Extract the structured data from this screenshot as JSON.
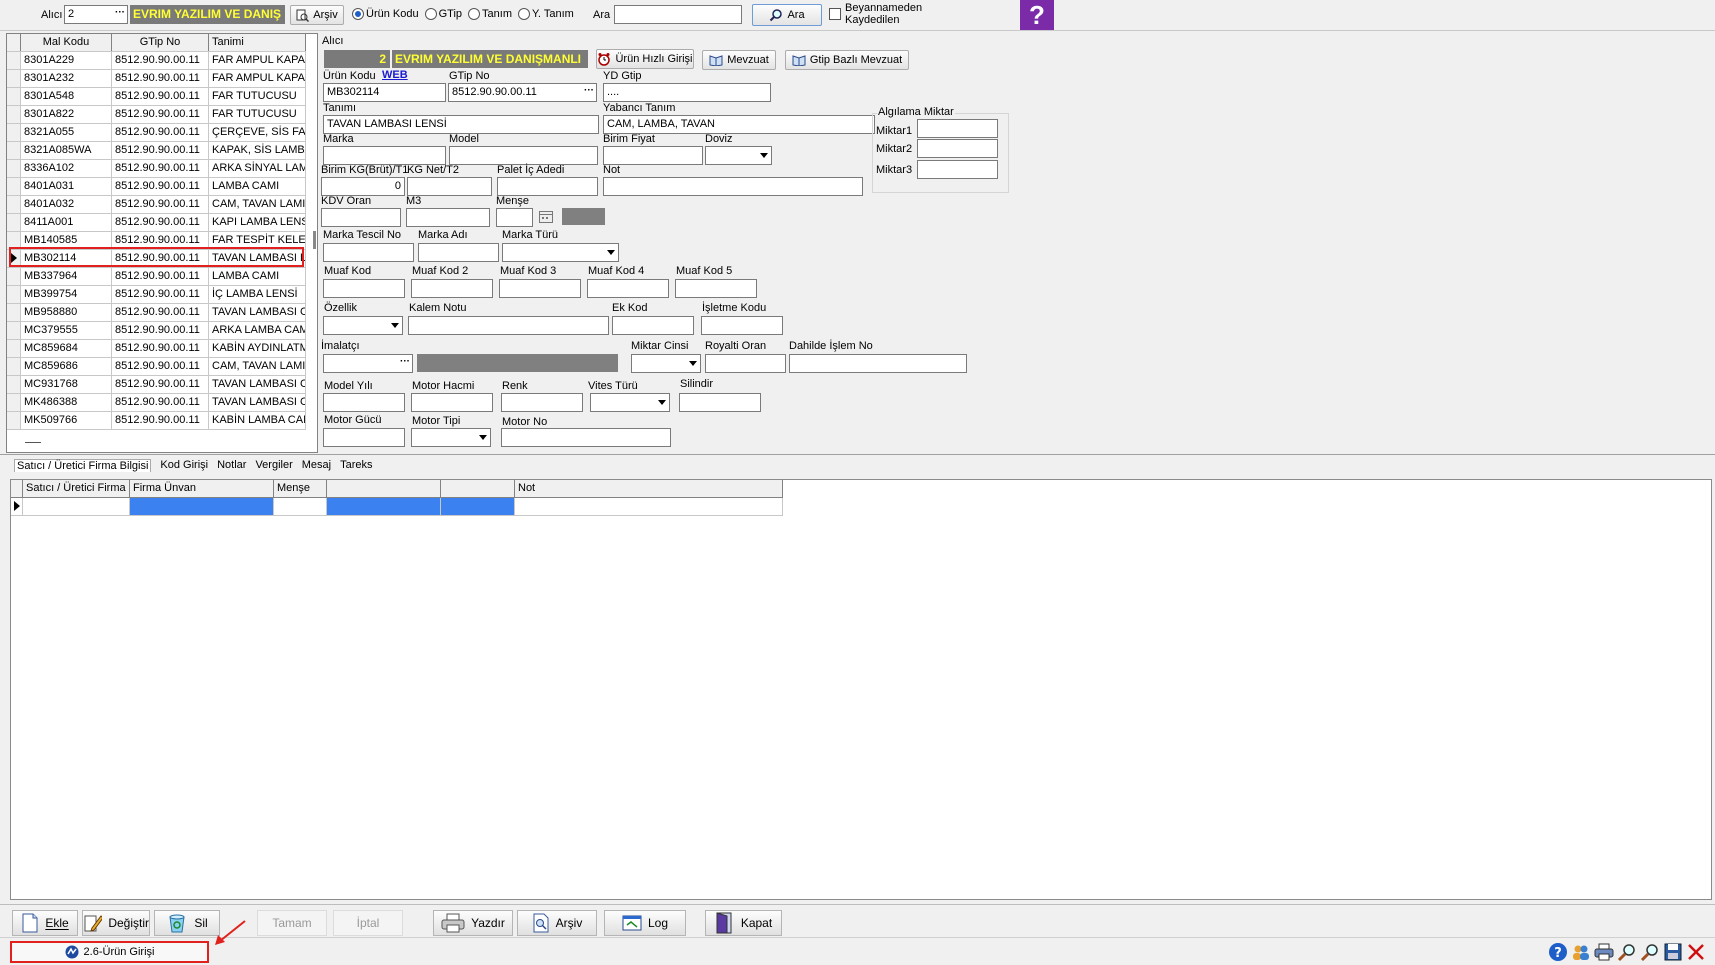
{
  "toolbar": {
    "alici_label": "Alıcı",
    "alici_value": "2",
    "company_name": "EVRIM YAZILIM VE DANIŞ",
    "archive_button": "Arşiv",
    "radio_options": [
      "Ürün Kodu",
      "GTip",
      "Tanım",
      "Y. Tanım"
    ],
    "radio_selected": 0,
    "search_label": "Ara",
    "search_value": "",
    "search_button": "Ara",
    "declared_checkbox": "Beyannameden Kaydedilen"
  },
  "left_grid": {
    "headers": [
      "Mal Kodu",
      "GTip No",
      "Tanimi"
    ],
    "rows": [
      [
        "8301A229",
        "8512.90.90.00.11",
        "FAR AMPUL KAPA"
      ],
      [
        "8301A232",
        "8512.90.90.00.11",
        "FAR AMPUL KAPA"
      ],
      [
        "8301A548",
        "8512.90.90.00.11",
        "FAR TUTUCUSU"
      ],
      [
        "8301A822",
        "8512.90.90.00.11",
        "FAR TUTUCUSU"
      ],
      [
        "8321A055",
        "8512.90.90.00.11",
        "ÇERÇEVE, SİS FAF"
      ],
      [
        "8321A085WA",
        "8512.90.90.00.11",
        "KAPAK, SİS LAMBA"
      ],
      [
        "8336A102",
        "8512.90.90.00.11",
        "ARKA SİNYAL LAM"
      ],
      [
        "8401A031",
        "8512.90.90.00.11",
        "LAMBA CAMI"
      ],
      [
        "8401A032",
        "8512.90.90.00.11",
        "CAM, TAVAN LAMI"
      ],
      [
        "8411A001",
        "8512.90.90.00.11",
        "KAPI LAMBA LENS"
      ],
      [
        "MB140585",
        "8512.90.90.00.11",
        "FAR TESPİT KELE"
      ],
      [
        "MB302114",
        "8512.90.90.00.11",
        "TAVAN LAMBASI L"
      ],
      [
        "MB337964",
        "8512.90.90.00.11",
        "LAMBA CAMI"
      ],
      [
        "MB399754",
        "8512.90.90.00.11",
        "İÇ LAMBA LENSİ"
      ],
      [
        "MB958880",
        "8512.90.90.00.11",
        "TAVAN LAMBASI C"
      ],
      [
        "MC379555",
        "8512.90.90.00.11",
        "ARKA LAMBA CAM"
      ],
      [
        "MC859684",
        "8512.90.90.00.11",
        "KABİN AYDINLATM"
      ],
      [
        "MC859686",
        "8512.90.90.00.11",
        "CAM, TAVAN LAMI"
      ],
      [
        "MC931768",
        "8512.90.90.00.11",
        "TAVAN LAMBASI C"
      ],
      [
        "MK486388",
        "8512.90.90.00.11",
        "TAVAN LAMBASI C"
      ],
      [
        "MK509766",
        "8512.90.90.00.11",
        "KABİN LAMBA CAM"
      ]
    ],
    "selected_index": 11
  },
  "form": {
    "alici_label": "Alıcı",
    "alici_number": "2",
    "alici_name": "EVRIM YAZILIM VE DANIŞMANLI",
    "quick_entry_button": "Ürün Hızlı Girişi",
    "mevzuat_button": "Mevzuat",
    "gtip_mevzuat_button": "Gtip Bazlı Mevzuat",
    "urun_kodu_label": "Ürün Kodu",
    "web_link": "WEB",
    "urun_kodu_value": "MB302114",
    "gtip_no_label": "GTip No",
    "gtip_no_value": "8512.90.90.00.11",
    "yd_gtip_label": "YD Gtip",
    "yd_gtip_value": "....",
    "tanimi_label": "Tanımı",
    "tanimi_value": "TAVAN LAMBASI LENSİ",
    "yabanci_tanim_label": "Yabancı Tanım",
    "yabanci_tanim_value": "CAM, LAMBA, TAVAN",
    "marka_label": "Marka",
    "model_label": "Model",
    "birim_fiyat_label": "Birim Fiyat",
    "doviz_label": "Doviz",
    "birim_kg_label": "Birim KG(Brüt)/T1",
    "birim_kg_value": "0",
    "kg_net_label": "KG Net/T2",
    "palet_label": "Palet İç Adedi",
    "not_label": "Not",
    "kdv_label": "KDV Oran",
    "m3_label": "M3",
    "mense_label": "Menşe",
    "marka_tescil_label": "Marka Tescil No",
    "marka_adi_label": "Marka Adı",
    "marka_turu_label": "Marka Türü",
    "muaf_labels": [
      "Muaf Kod",
      "Muaf Kod 2",
      "Muaf Kod 3",
      "Muaf Kod 4",
      "Muaf Kod 5"
    ],
    "ozellik_label": "Özellik",
    "kalem_notu_label": "Kalem Notu",
    "ek_kod_label": "Ek Kod",
    "isletme_kodu_label": "İşletme Kodu",
    "imalatci_label": "İmalatçı",
    "miktar_cinsi_label": "Miktar Cinsi",
    "royalti_label": "Royalti Oran",
    "dahilde_label": "Dahilde İşlem No",
    "model_yili_label": "Model Yılı",
    "motor_hacmi_label": "Motor Hacmi",
    "renk_label": "Renk",
    "vites_label": "Vites Türü",
    "silindir_label": "Silindir",
    "motor_gucu_label": "Motor Gücü",
    "motor_tipi_label": "Motor Tipi",
    "motor_no_label": "Motor No",
    "algilama_title": "Algılama Miktar",
    "miktar_labels": [
      "Miktar1",
      "Miktar2",
      "Miktar3"
    ]
  },
  "tabs": [
    "Satıcı / Üretici Firma Bilgisi",
    "Kod Girişi",
    "Notlar",
    "Vergiler",
    "Mesaj",
    "Tareks"
  ],
  "lower_grid": {
    "headers": [
      "Satıcı / Üretici Firma",
      "Firma Ünvan",
      "Menşe",
      "",
      "",
      "Not"
    ]
  },
  "bottom_buttons": [
    "Ekle",
    "Değiştir",
    "Sil",
    "Tamam",
    "İptal",
    "Yazdır",
    "Arşiv",
    "Log",
    "Kapat"
  ],
  "status_tab": "2.6-Ürün Girişi",
  "colors": {
    "highlight": "#e0211d",
    "selection_blue": "#3b82f0",
    "yellow_text": "#ffff33",
    "help_purple": "#7b2aa8"
  }
}
